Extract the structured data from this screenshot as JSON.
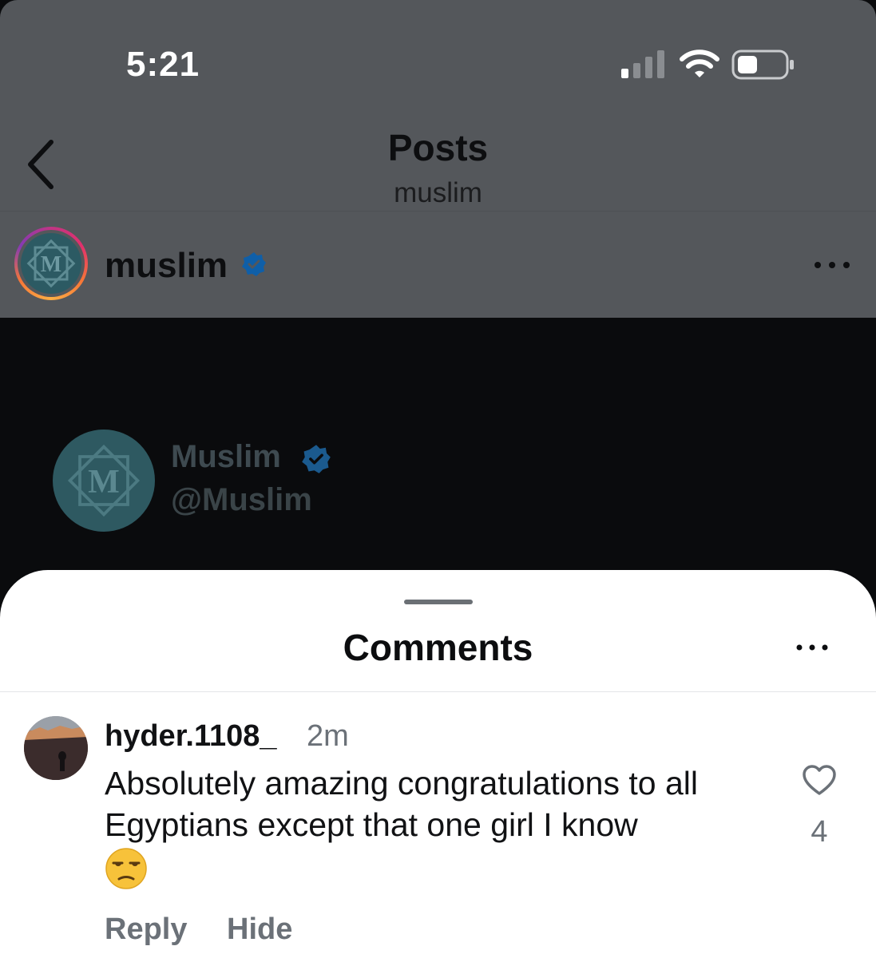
{
  "status_bar": {
    "time": "5:21",
    "signal_icon": "cellular-signal-icon",
    "wifi_icon": "wifi-icon",
    "battery_icon": "battery-icon"
  },
  "nav": {
    "back_icon": "chevron-left-icon",
    "title": "Posts",
    "subtitle": "muslim"
  },
  "post": {
    "username": "muslim",
    "verified_icon": "verified-badge-icon",
    "more_icon": "more-horizontal-icon",
    "embed": {
      "logo_letter": "M",
      "name": "Muslim",
      "handle": "@Muslim"
    }
  },
  "comments_sheet": {
    "title": "Comments",
    "more_icon": "more-horizontal-icon",
    "comments": [
      {
        "username": "hyder.1108_",
        "time": "2m",
        "text": "Absolutely amazing congratulations to all Egyptians except that one girl I know",
        "emoji": "😒",
        "likes": "4",
        "reply_label": "Reply",
        "hide_label": "Hide"
      }
    ]
  },
  "colors": {
    "dim_overlay": "#54575b",
    "verified_blue": "#0f5fa8",
    "secondary_text": "#6b7178"
  }
}
